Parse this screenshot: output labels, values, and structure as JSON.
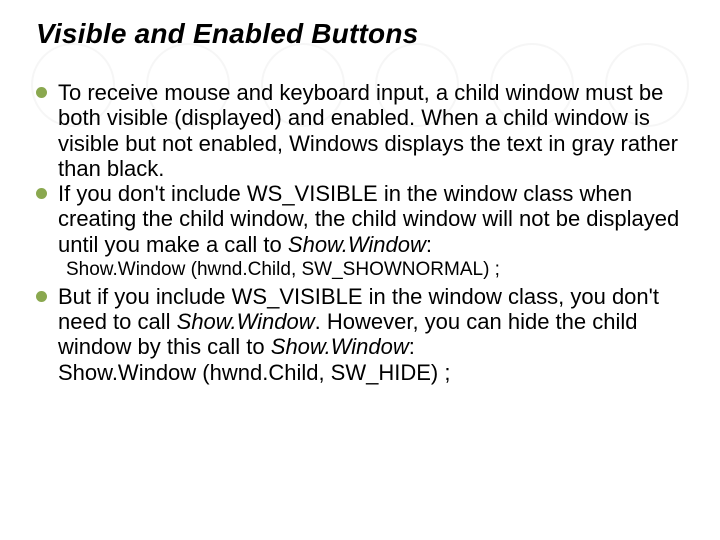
{
  "title": "Visible and Enabled Buttons",
  "bullets": {
    "b1": "To receive mouse and keyboard input, a child window must be both visible (displayed) and enabled. When a child window is visible but not enabled, Windows displays the text in gray rather than black.",
    "b2_pre": "If you don't include WS_VISIBLE in the window class when creating the child window, the child window will not be displayed until you make a call to ",
    "b2_ital": "Show.Window",
    "b2_post": ":",
    "code1": "Show.Window (hwnd.Child, SW_SHOWNORMAL) ;",
    "b3_a": "But if you include WS_VISIBLE in the window class, you don't need to call ",
    "b3_ital1": "Show.Window",
    "b3_b": ". However, you can hide the child window by this call to ",
    "b3_ital2": "Show.Window",
    "b3_c": ":",
    "code2": "Show.Window (hwnd.Child, SW_HIDE) ;"
  }
}
